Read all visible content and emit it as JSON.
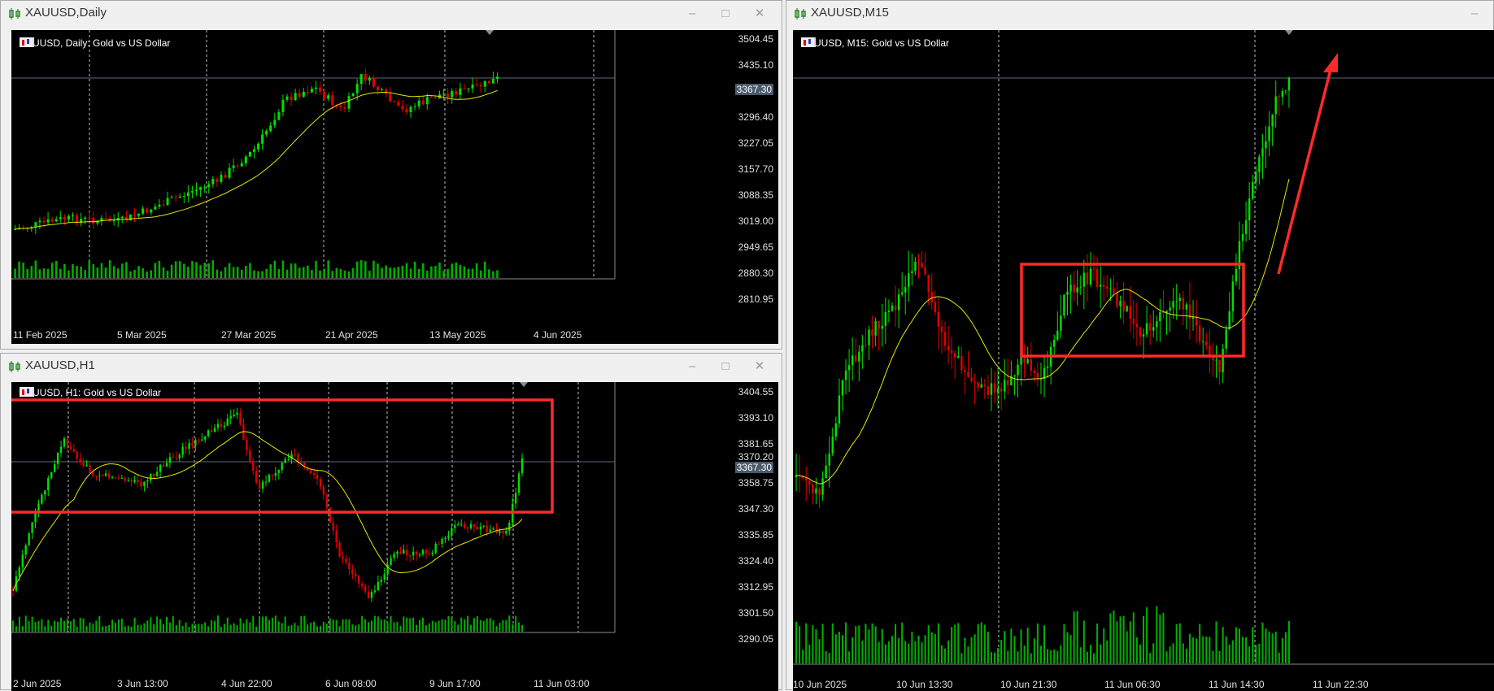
{
  "windows": {
    "daily": {
      "title": "XAUUSD,Daily",
      "chart_label": "XAUUSD, Daily:  Gold vs US Dollar",
      "prices": [
        "3504.45",
        "3435.10",
        "3367.30",
        "3296.40",
        "3227.05",
        "3157.70",
        "3088.35",
        "3019.00",
        "2949.65",
        "2880.30",
        "2810.95"
      ],
      "current_price": "3367.30",
      "dates": [
        "11 Feb 2025",
        "5 Mar 2025",
        "27 Mar 2025",
        "21 Apr 2025",
        "13 May 2025",
        "4 Jun 2025"
      ]
    },
    "h1": {
      "title": "XAUUSD,H1",
      "chart_label": "XAUUSD, H1:  Gold vs US Dollar",
      "prices": [
        "3404.55",
        "3393.10",
        "3381.65",
        "3370.20",
        "3358.75",
        "3347.30",
        "3335.85",
        "3324.40",
        "3312.95",
        "3301.50",
        "3290.05"
      ],
      "current_price": "3367.30",
      "dates": [
        "2 Jun 2025",
        "3 Jun 13:00",
        "4 Jun 22:00",
        "6 Jun 08:00",
        "9 Jun 17:00",
        "11 Jun 03:00"
      ]
    },
    "m15": {
      "title": "XAUUSD,M15",
      "chart_label": "XAUUSD, M15:  Gold vs US Dollar",
      "dates": [
        "10 Jun 2025",
        "10 Jun 13:30",
        "10 Jun 21:30",
        "11 Jun 06:30",
        "11 Jun 14:30",
        "11 Jun 22:30"
      ]
    }
  },
  "controls": {
    "minimize": "–",
    "maximize": "□",
    "close": "✕"
  },
  "colors": {
    "bull": "#00e000",
    "bear": "#e00000",
    "ma": "#e6e600",
    "annotation": "#ff2a2a",
    "volume": "#00b000"
  }
}
